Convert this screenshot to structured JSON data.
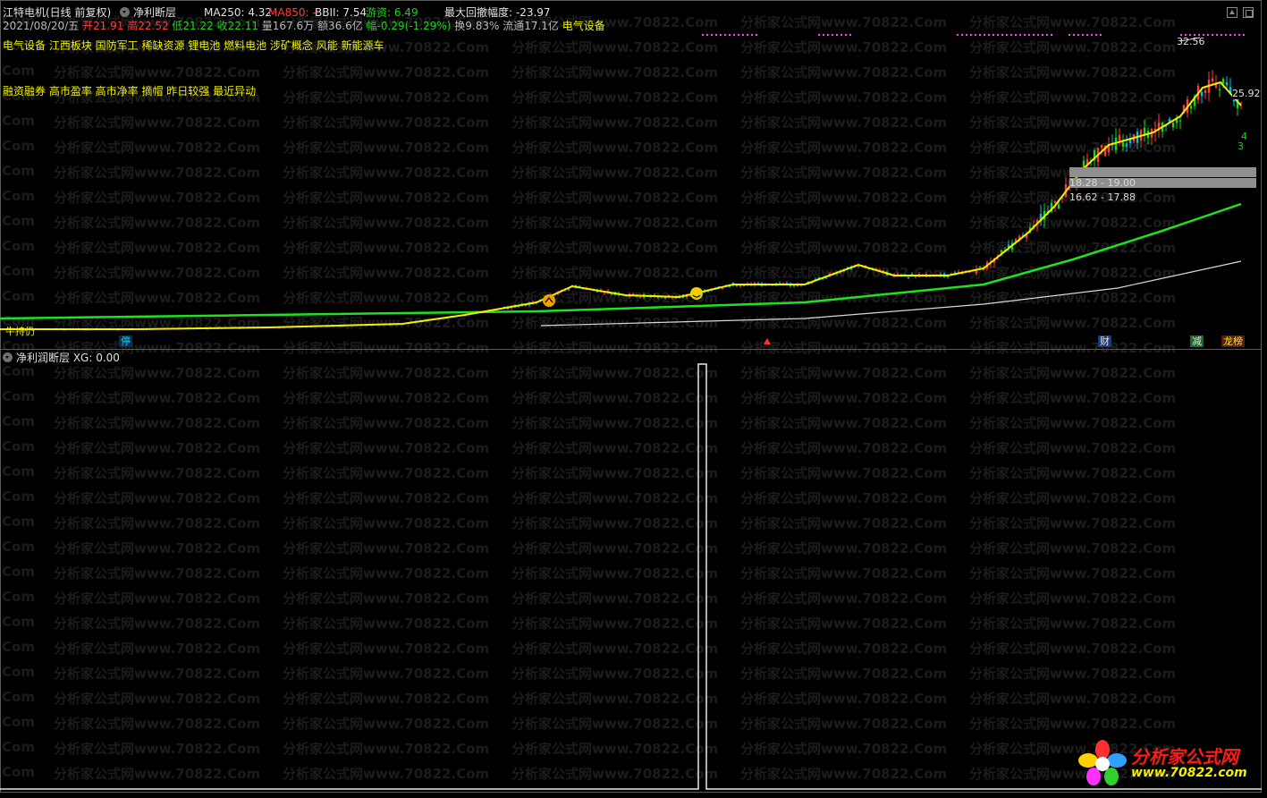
{
  "header": {
    "stock_title": "江特电机(日线 前复权)",
    "indicator_name": "净利断层",
    "ma250": "MA250: 4.32",
    "ma850": "MA850: -",
    "bbii": "BBII: 7.54",
    "youzi": "游资: 6.49",
    "max_drawdown": "最大回撤幅度: -23.97"
  },
  "quote": {
    "date": "2021/08/20/五",
    "open": "开21.91",
    "high": "高22.52",
    "low": "低21.22",
    "close": "收22.11",
    "volume": "量167.6万",
    "amount": "额36.6亿",
    "change": "幅-0.29(-1.29%)",
    "turnover": "换9.83%",
    "float": "流通17.1亿",
    "sector": "电气设备"
  },
  "tags": {
    "line1": "电气设备 江西板块 国防军工 稀缺资源 锂电池 燃料电池 涉矿概念 风能 新能源车",
    "line2": "融资融券 高市盈率 高市净率 摘帽 昨日较强 最近异动"
  },
  "price_labels": {
    "high": "32.56",
    "right_level": "25.92",
    "num4": "4",
    "num3": "3",
    "zone1": "18.28 - 19.00",
    "zone2": "16.62 - 17.88"
  },
  "bottom_markers": {
    "left_text": "牛持仍",
    "ting": "停",
    "cai": "财",
    "jian": "减",
    "longhu": "龙榜"
  },
  "sub_panel": {
    "title": "净利润断层 XG: 0.00"
  },
  "watermark": {
    "text": "分析家公式网www.70822.Com",
    "short": "Com"
  },
  "logo": {
    "name": "分析家公式网",
    "url": "www.70822.com"
  },
  "colors": {
    "up": "#ff3c3c",
    "down": "#18d518",
    "ma_yellow": "#f0f000",
    "ma_green": "#1ee21e",
    "ma_white": "#d8d8d8"
  }
}
